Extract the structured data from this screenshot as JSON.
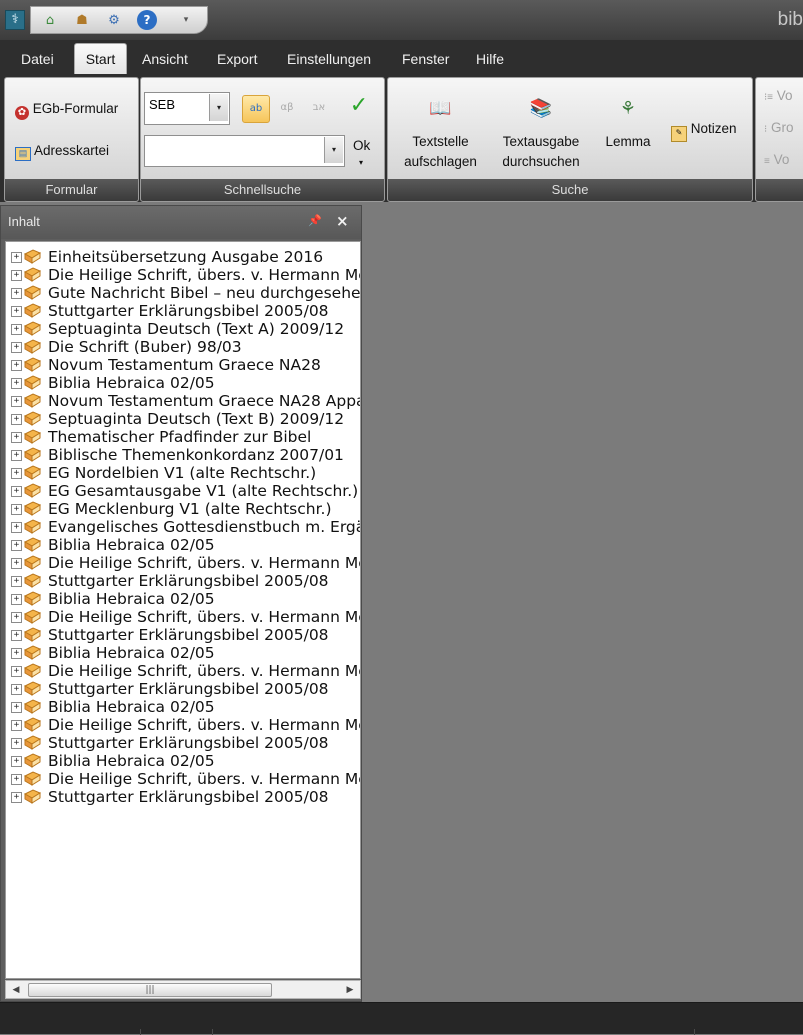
{
  "titlebar": {
    "title": "bib",
    "qat_icons": [
      "home-icon",
      "user-home-icon",
      "settings-icon",
      "help-icon",
      "customize-icon"
    ]
  },
  "menu": [
    "Datei",
    "Start",
    "Ansicht",
    "Export",
    "Einstellungen",
    "Fenster",
    "Hilfe"
  ],
  "ribbon": {
    "formular": {
      "caption": "Formular",
      "egb": "EGb-Formular",
      "adress": "Adresskartei"
    },
    "schnellsuche": {
      "caption": "Schnellsuche",
      "combo_value": "SEB",
      "search_value": "",
      "ok": "Ok"
    },
    "suche": {
      "caption": "Suche",
      "textstelle_1": "Textstelle",
      "textstelle_2": "aufschlagen",
      "textausgabe_1": "Textausgabe",
      "textausgabe_2": "durchsuchen",
      "lemma": "Lemma",
      "notizen": "Notizen"
    },
    "right_partial": [
      "Vo",
      "Gro",
      "Vo"
    ]
  },
  "panel": {
    "title": "Inhalt",
    "items": [
      "Einheitsübersetzung Ausgabe 2016",
      "Die Heilige Schrift, übers. v. Hermann Me",
      "Gute Nachricht Bibel – neu durchgesehe",
      "Stuttgarter Erklärungsbibel 2005/08",
      "Septuaginta Deutsch (Text A) 2009/12",
      "Die Schrift (Buber) 98/03",
      "Novum Testamentum Graece NA28",
      "Biblia Hebraica 02/05",
      "Novum Testamentum Graece NA28 Appa",
      "Septuaginta Deutsch (Text B) 2009/12",
      "Thematischer Pfadfinder zur Bibel",
      "Biblische Themenkonkordanz 2007/01",
      "EG Nordelbien V1 (alte Rechtschr.)",
      "EG Gesamtausgabe V1 (alte Rechtschr.)",
      "EG Mecklenburg V1 (alte Rechtschr.)",
      "Evangelisches Gottesdienstbuch m. Ergän",
      "Biblia Hebraica 02/05",
      "Die Heilige Schrift, übers. v. Hermann Me",
      "Stuttgarter Erklärungsbibel 2005/08",
      "Biblia Hebraica 02/05",
      "Die Heilige Schrift, übers. v. Hermann Me",
      "Stuttgarter Erklärungsbibel 2005/08",
      "Biblia Hebraica 02/05",
      "Die Heilige Schrift, übers. v. Hermann Me",
      "Stuttgarter Erklärungsbibel 2005/08",
      "Biblia Hebraica 02/05",
      "Die Heilige Schrift, übers. v. Hermann Me",
      "Stuttgarter Erklärungsbibel 2005/08",
      "Biblia Hebraica 02/05",
      "Die Heilige Schrift, übers. v. Hermann Me",
      "Stuttgarter Erklärungsbibel 2005/08"
    ]
  },
  "colors": {
    "accent_menu": "#2e2e2e",
    "book": "#e8a33a",
    "ok_check": "#2aa52a"
  }
}
